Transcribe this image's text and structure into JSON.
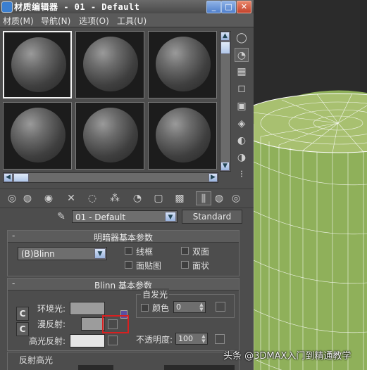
{
  "window": {
    "title": "材质编辑器 - 01 - Default",
    "minimize_label": "_",
    "maximize_label": "□",
    "close_label": "✕"
  },
  "menu": [
    "材质(M)",
    "导航(N)",
    "选项(O)",
    "工具(U)"
  ],
  "slots": {
    "count": 6,
    "selected_index": 0,
    "slot_labels": [
      "slot-1",
      "slot-2",
      "slot-3",
      "slot-4",
      "slot-5",
      "slot-6"
    ]
  },
  "side_tools": [
    "sample-type-icon",
    "backlight-icon",
    "background-icon",
    "uv-tiling-icon",
    "video-color-check-icon",
    "make-preview-icon",
    "options-icon",
    "select-by-material-icon",
    "material-map-navigator-icon"
  ],
  "toolbar_tools": [
    "get-material-icon",
    "put-to-scene-icon",
    "assign-to-selection-icon",
    "reset-map-icon",
    "make-unique-icon",
    "put-to-library-icon",
    "material-id-icon",
    "show-in-viewport-icon",
    "show-end-result-icon",
    "go-to-parent-icon",
    "go-forward-icon"
  ],
  "material": {
    "name": "01 - Default",
    "type_button": "Standard"
  },
  "shader_rollout": {
    "title": "明暗器基本参数",
    "collapse": "-",
    "shader": "(B)Blinn",
    "wire": "线框",
    "two_sided": "双面",
    "face_map": "面贴图",
    "faceted": "面状"
  },
  "blinn_rollout": {
    "title": "Blinn 基本参数",
    "collapse": "-",
    "lock_top": "C",
    "lock_bottom": "C",
    "ambient_label": "环境光:",
    "diffuse_label": "漫反射:",
    "specular_label": "高光反射:",
    "self_illum_group": "自发光",
    "color_label": "颜色",
    "color_value": "0",
    "opacity_label": "不透明度:",
    "opacity_value": "100",
    "colors": {
      "ambient": "#9c9c9c",
      "diffuse": "#9c9c9c",
      "specular": "#e6e6e6"
    }
  },
  "next_rollout": {
    "title": "反射高光"
  },
  "viewport": {
    "cylinder_color": "#8fb05a"
  },
  "highlight": {
    "color": "#d82020"
  },
  "watermark": "头条 @3DMAX入门到精通教学"
}
